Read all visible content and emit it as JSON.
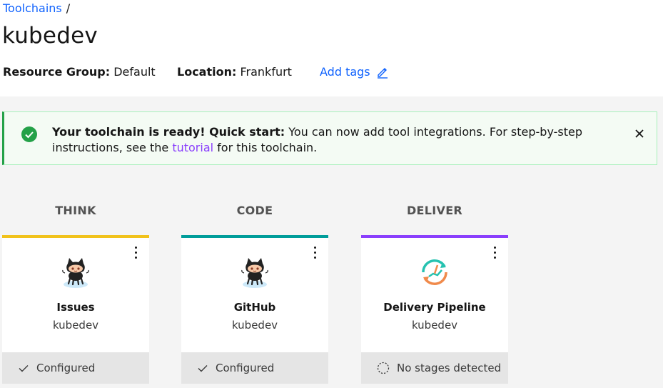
{
  "breadcrumb": {
    "link": "Toolchains",
    "separator": "/"
  },
  "page": {
    "title": "kubedev"
  },
  "meta": {
    "resource_group_label": "Resource Group:",
    "resource_group_value": "Default",
    "location_label": "Location:",
    "location_value": "Frankfurt",
    "add_tags": "Add tags"
  },
  "notification": {
    "title": "Your toolchain is ready! Quick start:",
    "body_1": "You can now add tool integrations. For step-by-step instructions, see the",
    "link": "tutorial",
    "body_2": "for this toolchain.",
    "colors": {
      "accent": "#24a148",
      "link": "#8a3ffc"
    }
  },
  "phases": [
    {
      "label": "THINK",
      "color": "#f1c21b"
    },
    {
      "label": "CODE",
      "color": "#009d9a"
    },
    {
      "label": "DELIVER",
      "color": "#8a3ffc"
    }
  ],
  "cards": [
    {
      "name": "Issues",
      "sub": "kubedev",
      "status": "Configured",
      "icon": "github-octocat-icon",
      "status_icon": "checkmark-icon"
    },
    {
      "name": "GitHub",
      "sub": "kubedev",
      "status": "Configured",
      "icon": "github-octocat-icon",
      "status_icon": "checkmark-icon"
    },
    {
      "name": "Delivery Pipeline",
      "sub": "kubedev",
      "status": "No stages detected",
      "icon": "delivery-pipeline-icon",
      "status_icon": "pending-circle-icon"
    }
  ]
}
